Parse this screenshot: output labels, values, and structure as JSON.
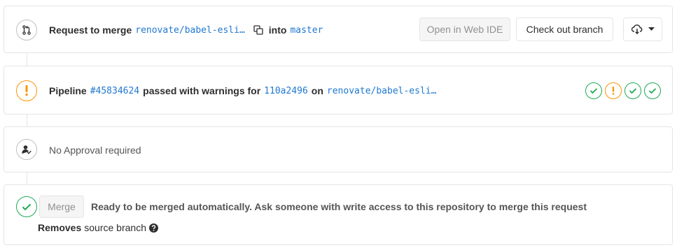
{
  "merge_request": {
    "prefix": "Request to merge",
    "source_branch": "renovate/babel-esli…",
    "into_label": "into",
    "target_branch": "master",
    "open_web_ide_label": "Open in Web IDE",
    "checkout_label": "Check out branch"
  },
  "pipeline": {
    "label": "Pipeline",
    "id": "#45834624",
    "status_text": "passed with warnings for",
    "commit": "110a2496",
    "on_label": "on",
    "branch": "renovate/babel-esli…",
    "stages": [
      "success",
      "warning",
      "success",
      "success"
    ]
  },
  "approval": {
    "text": "No Approval required"
  },
  "merge": {
    "button_label": "Merge",
    "status_text": "Ready to be merged automatically. Ask someone with write access to this repository to merge this request",
    "removes_label": "Removes",
    "source_branch_label": "source branch"
  },
  "colors": {
    "success": "#1aaa55",
    "warning": "#fc9403",
    "link": "#1f78d1",
    "border": "#e5e5e5"
  }
}
